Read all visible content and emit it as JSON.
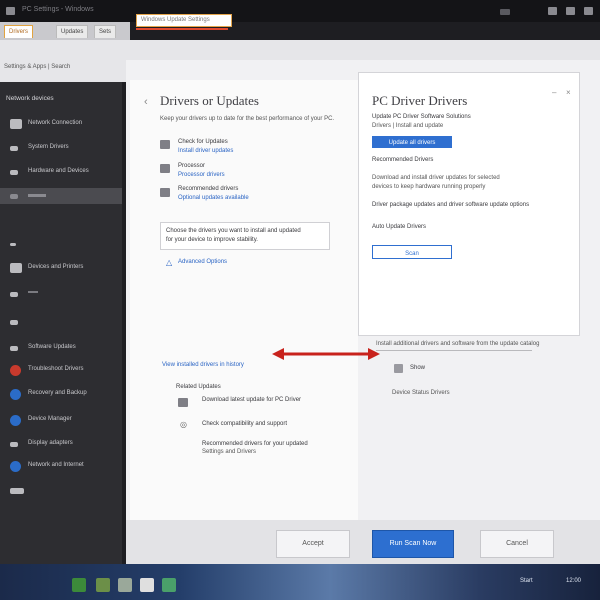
{
  "topbar": {
    "title": "PC Settings - Windows"
  },
  "tabs": [
    {
      "label": "Drivers",
      "active": true
    },
    {
      "label": "Updates",
      "active": false
    },
    {
      "label": "Sets",
      "active": false
    }
  ],
  "address": {
    "left_text": "Settings & Apps  |  Search",
    "field_value": "Windows Update Settings"
  },
  "sidebar": {
    "title": "Network devices",
    "items": [
      {
        "label": "Network Connection",
        "icon": "monitor-icon",
        "color": "#bbbbbf"
      },
      {
        "label": "System Drivers",
        "icon": "device-icon",
        "color": "#bbbbbf"
      },
      {
        "label": "Hardware and Devices",
        "icon": "drive-icon",
        "color": "#bbbbbf"
      },
      {
        "label": "",
        "icon": "",
        "color": "#4b4b50"
      },
      {
        "label": "",
        "icon": "arrow-icon",
        "color": "#bbbbbf"
      },
      {
        "label": "Devices and Printers",
        "icon": "printer-icon",
        "color": "#bbbbbf"
      },
      {
        "label": "",
        "icon": "usb-icon",
        "color": "#bbbbbf"
      },
      {
        "label": "",
        "icon": "card-icon",
        "color": "#bbbbbf"
      },
      {
        "label": "Software Updates",
        "icon": "cable-icon",
        "color": "#bbbbbf"
      },
      {
        "label": "Troubleshoot Drivers",
        "icon": "shield-icon",
        "color": "#c83a2d"
      },
      {
        "label": "Recovery and Backup",
        "icon": "disc-icon",
        "color": "#2b6cc8"
      },
      {
        "label": "Device Manager",
        "icon": "gear-icon",
        "color": "#2b6cc8"
      },
      {
        "label": "Display adapters",
        "icon": "display-icon",
        "color": "#bbbbbf"
      },
      {
        "label": "Network and Internet",
        "icon": "globe-icon",
        "color": "#2b6cc8"
      }
    ]
  },
  "left_panel": {
    "heading": "Drivers or Updates",
    "description": "Keep your drivers up to date for the best performance of your PC.",
    "options": [
      {
        "label": "Check for Updates",
        "sub": "Install driver updates",
        "icon": "monitor-icon"
      },
      {
        "label": "Processor",
        "sub": "Processor drivers",
        "icon": "chip-icon"
      },
      {
        "label": "Recommended drivers",
        "sub": "Optional updates available",
        "icon": "box-icon"
      }
    ],
    "info_text_1": "Choose the drivers you want to install and updated",
    "info_text_2": "for your device to improve stability.",
    "info_link": "Advanced Options",
    "bottom_link": "View installed drivers in history",
    "section_title": "Related Updates",
    "related": [
      {
        "label": "Download latest update for PC Driver",
        "icon": "download-icon"
      },
      {
        "label": "Check compatibility and support",
        "icon": "check-icon"
      },
      {
        "label": "Recommended drivers for your updated",
        "icon": "star-icon"
      },
      {
        "label": "Settings and Drivers",
        "icon": ""
      }
    ]
  },
  "right_panel": {
    "heading": "PC Driver Drivers",
    "description": "Update PC Driver Software Solutions",
    "description_sub": "Drivers  |  Install and update",
    "primary_button": "Update all drivers",
    "section1": "Recommended Drivers",
    "section1_text": "Download and install driver updates for selected",
    "section1_text2": "devices to keep hardware running properly",
    "section2": "Driver package updates and driver software update options",
    "section3": "Auto Update Drivers",
    "outline_button": "Scan",
    "sep_text": "Install additional drivers and software from the update catalog",
    "item_icon_label": "Show",
    "item_text": "Device Status Drivers"
  },
  "bottom_bar": {
    "button1": "Accept",
    "button2": "Run Scan Now",
    "button3": "Cancel"
  },
  "taskbar": {
    "label": "Start",
    "time": "12:00"
  }
}
